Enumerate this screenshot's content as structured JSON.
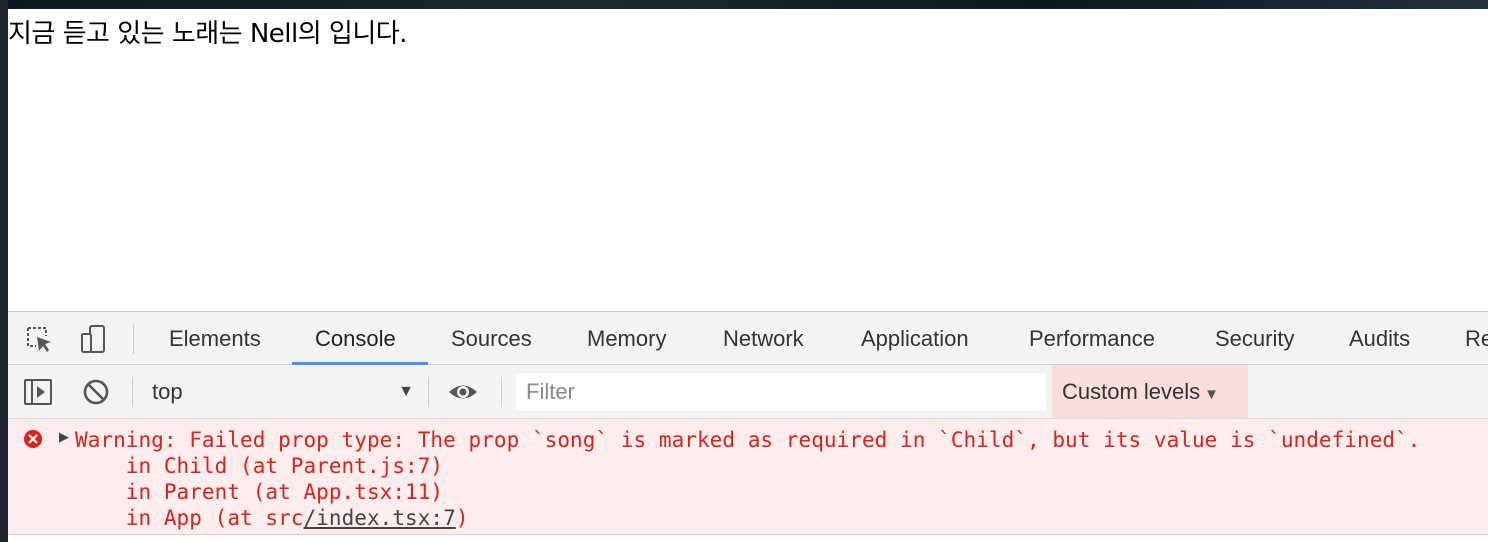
{
  "page": {
    "text": "지금 듣고 있는 노래는 Nell의 입니다."
  },
  "devtools": {
    "toolbar_icons": [
      "inspect-icon",
      "device-toggle-icon"
    ],
    "tabs": [
      {
        "label": "Elements"
      },
      {
        "label": "Console",
        "active": true
      },
      {
        "label": "Sources"
      },
      {
        "label": "Memory"
      },
      {
        "label": "Network"
      },
      {
        "label": "Application"
      },
      {
        "label": "Performance"
      },
      {
        "label": "Security"
      },
      {
        "label": "Audits"
      },
      {
        "label": "Re"
      }
    ],
    "console_toolbar": {
      "context": "top",
      "filter_placeholder": "Filter",
      "levels_label": "Custom levels",
      "icons": [
        "sidebar-toggle-icon",
        "clear-console-icon",
        "live-expression-eye-icon"
      ]
    },
    "messages": [
      {
        "level": "error",
        "lines": [
          "Warning: Failed prop type: The prop `song` is marked as required in `Child`, but its value is `undefined`.",
          "    in Child (at Parent.js:7)",
          "    in Parent (at App.tsx:11)"
        ],
        "last_line_prefix": "    in App (at src",
        "last_line_link": "/index.tsx:7",
        "last_line_suffix": ")"
      }
    ]
  },
  "colors": {
    "accent_tab": "#4d90fe",
    "error_text": "#e0201a",
    "error_bg": "#fdeded",
    "levels_bg": "#f9dede"
  }
}
